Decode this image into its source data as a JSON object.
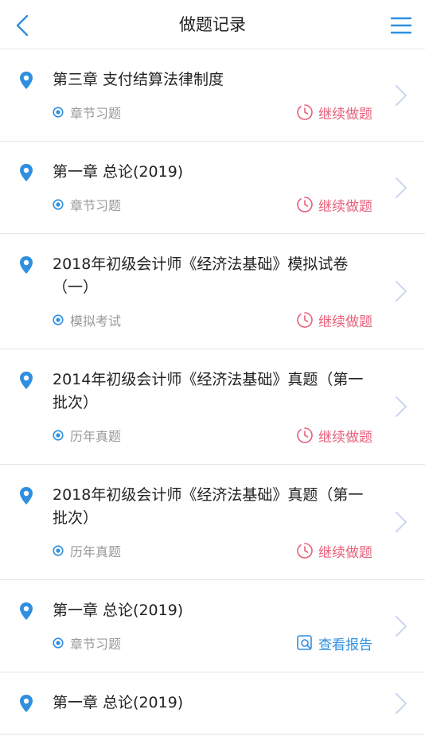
{
  "header": {
    "title": "做题记录"
  },
  "colors": {
    "accent": "#2f8fe0",
    "continue": "#e8607a",
    "muted": "#999999",
    "chevron": "#c9d6ee"
  },
  "records": [
    {
      "title": "第三章 支付结算法律制度",
      "type": "章节习题",
      "action": "继续做题",
      "action_kind": "continue",
      "action_icon": "timer-icon"
    },
    {
      "title": "第一章 总论(2019)",
      "type": "章节习题",
      "action": "继续做题",
      "action_kind": "continue",
      "action_icon": "timer-icon"
    },
    {
      "title": "2018年初级会计师《经济法基础》模拟试卷（一）",
      "type": "模拟考试",
      "action": "继续做题",
      "action_kind": "continue",
      "action_icon": "timer-icon"
    },
    {
      "title": "2014年初级会计师《经济法基础》真题（第一批次）",
      "type": "历年真题",
      "action": "继续做题",
      "action_kind": "continue",
      "action_icon": "timer-icon"
    },
    {
      "title": "2018年初级会计师《经济法基础》真题（第一批次）",
      "type": "历年真题",
      "action": "继续做题",
      "action_kind": "continue",
      "action_icon": "timer-icon"
    },
    {
      "title": "第一章 总论(2019)",
      "type": "章节习题",
      "action": "查看报告",
      "action_kind": "report",
      "action_icon": "report-search-icon"
    },
    {
      "title": "第一章 总论(2019)",
      "type": "",
      "action": "",
      "action_kind": "",
      "action_icon": ""
    }
  ]
}
